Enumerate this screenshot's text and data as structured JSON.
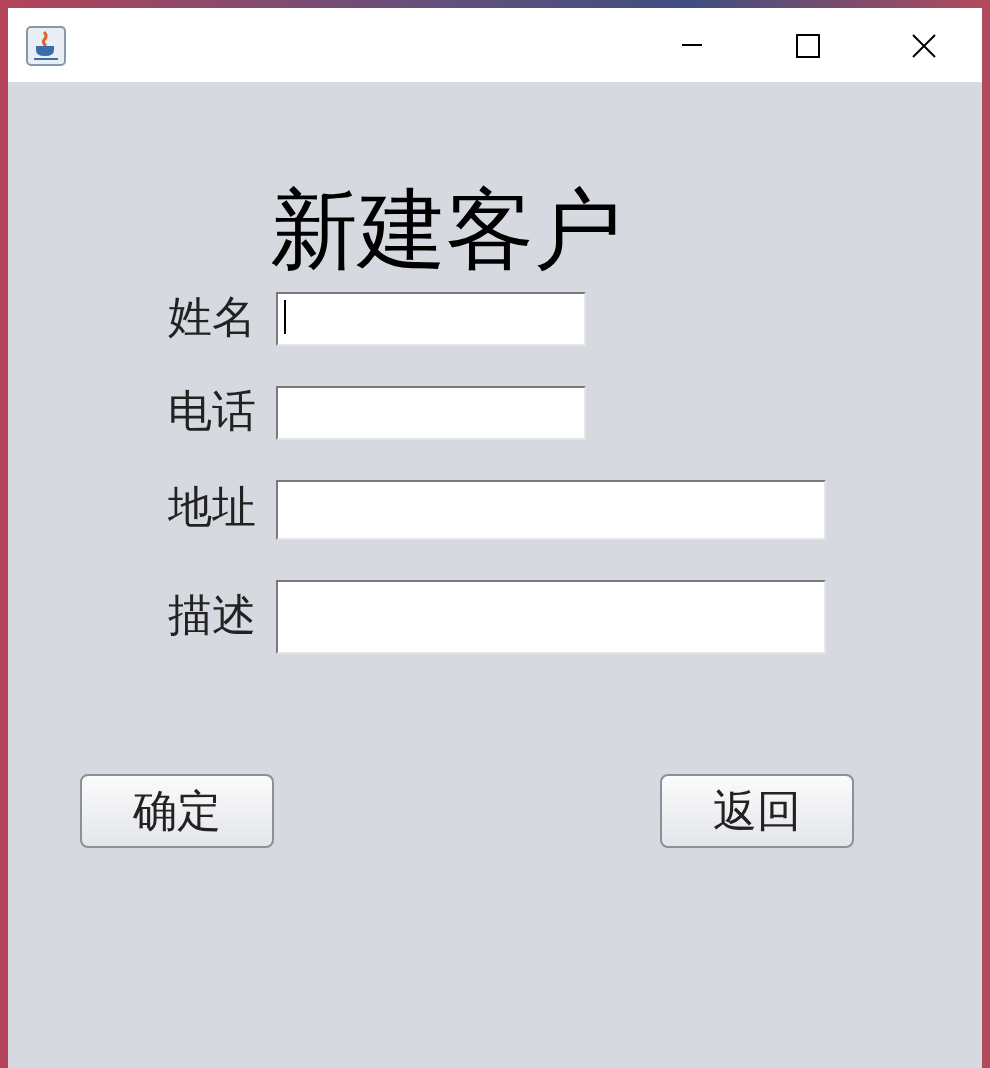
{
  "window": {
    "title": "新建客户"
  },
  "fields": [
    {
      "label": "姓名",
      "kind": "short",
      "focused": true
    },
    {
      "label": "电话",
      "kind": "short",
      "focused": false
    },
    {
      "label": "地址",
      "kind": "long",
      "focused": false
    },
    {
      "label": "描述",
      "kind": "tall",
      "focused": false
    }
  ],
  "buttons": [
    "确定",
    "返回"
  ]
}
